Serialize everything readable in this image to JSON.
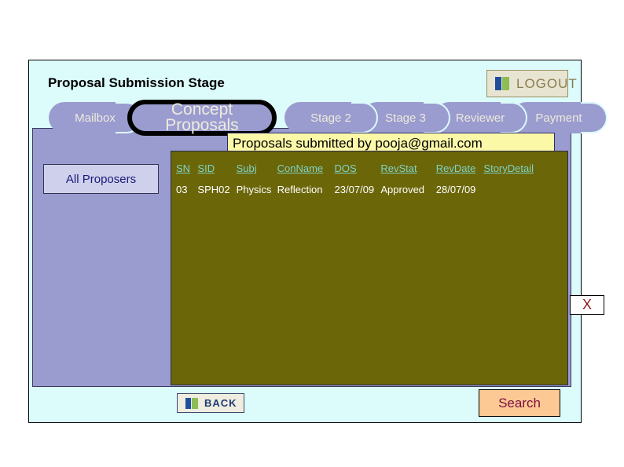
{
  "window": {
    "title": "Proposal Submission Stage"
  },
  "logout": {
    "label": "LOGOUT",
    "icon": "logout-bars-icon"
  },
  "tabs": [
    {
      "id": "mailbox",
      "label": "Mailbox",
      "selected": false
    },
    {
      "id": "concept",
      "label": "Concept Proposals",
      "selected": true
    },
    {
      "id": "stage2",
      "label": "Stage 2",
      "selected": false
    },
    {
      "id": "stage3",
      "label": "Stage 3",
      "selected": false
    },
    {
      "id": "reviewer",
      "label": "Reviewer",
      "selected": false
    },
    {
      "id": "payment",
      "label": "Payment",
      "selected": false
    }
  ],
  "banner": {
    "text": "Proposals submitted by pooja@gmail.com"
  },
  "sidebar": {
    "all_proposers_label": "All Proposers"
  },
  "table": {
    "headers": [
      "SN",
      "SID",
      "Subj",
      "ConName",
      "DOS",
      "RevStat",
      "RevDate",
      "StoryDetail"
    ],
    "rows": [
      {
        "sn": "03",
        "sid": "SPH02",
        "subj": "Physics",
        "conname": "Reflection",
        "dos": "23/07/09",
        "revstat": "Approved",
        "revdate": "28/07/09",
        "storydetail": ""
      }
    ]
  },
  "close_marker": {
    "label": "X"
  },
  "back": {
    "label": "BACK",
    "icon": "back-bars-icon"
  },
  "search": {
    "label": "Search"
  },
  "colors": {
    "window_bg": "#dcfbfb",
    "panel_lavender": "#9a9ccf",
    "results_olive": "#6b6608",
    "banner_yellow": "#fbf8a8",
    "search_peach": "#fcc894",
    "header_link": "#7fd3c6",
    "close_red": "#8b1a1a"
  }
}
